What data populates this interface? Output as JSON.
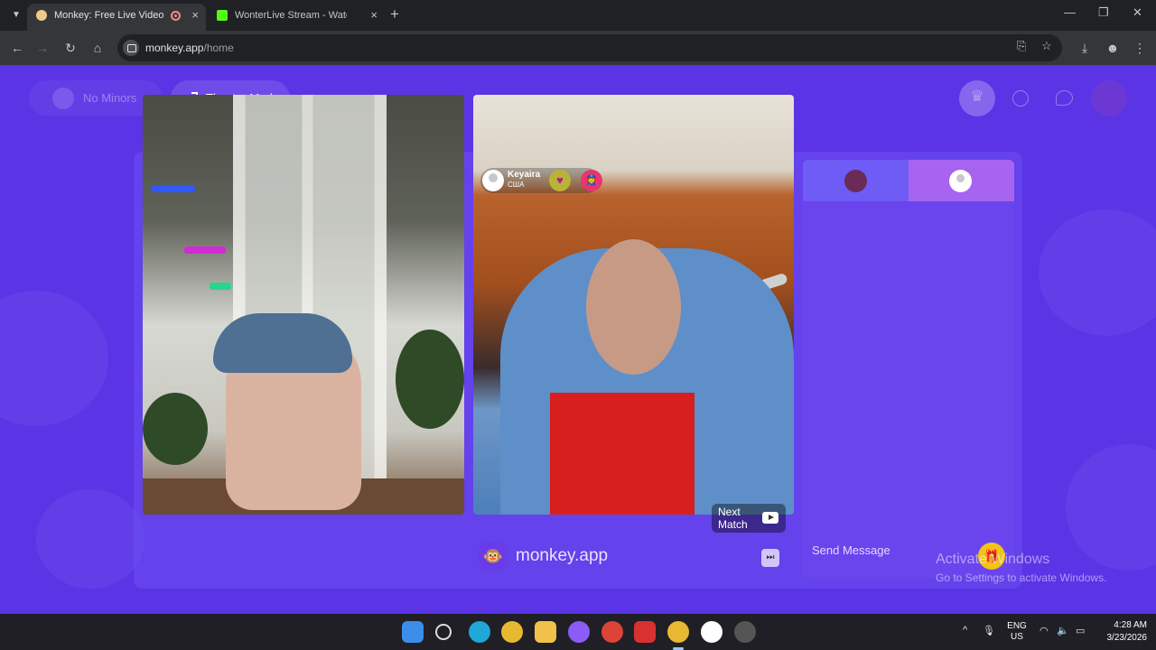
{
  "browser": {
    "tabs": [
      {
        "label": "Monkey: Free Live Video Chat",
        "active": true
      },
      {
        "label": "WonterLive Stream - Watch Live",
        "active": false
      }
    ],
    "new_tab": "+",
    "close": "×",
    "window_controls": {
      "minimize": "—",
      "restore": "❐",
      "close": "✕"
    },
    "nav": {
      "back": "←",
      "forward": "→",
      "reload": "↻",
      "home": "⌂"
    },
    "url": {
      "host": "monkey.app",
      "path": "/home"
    },
    "omni_icons": {
      "install": "⎘",
      "bookmark": "☆",
      "download": "⤓",
      "profile": "☻",
      "menu": "⋮"
    }
  },
  "page": {
    "no_minors_label": "No Minors",
    "theater_mode_label": "Theater Mode",
    "peer": {
      "name": "Keyaira",
      "country": "США",
      "heart": "♥",
      "cop": "👮"
    },
    "next_match_label": "Next Match",
    "skip": "⏭",
    "brand_logo": "🐵",
    "brand_text": "monkey.app",
    "chat": {
      "placeholder": "Send Message",
      "gift": "🎁"
    },
    "watermark": {
      "line1": "Activate Windows",
      "line2": "Go to Settings to activate Windows."
    },
    "accent_color": "#5b34e6"
  },
  "taskbar": {
    "language": {
      "line1": "ENG",
      "line2": "US"
    },
    "time": "4:28 AM",
    "date": "3/23/2026",
    "tray_icons": {
      "chevron": "^",
      "mic": "🎙",
      "wifi": "◠",
      "volume": "🔈",
      "battery": "▭"
    }
  }
}
